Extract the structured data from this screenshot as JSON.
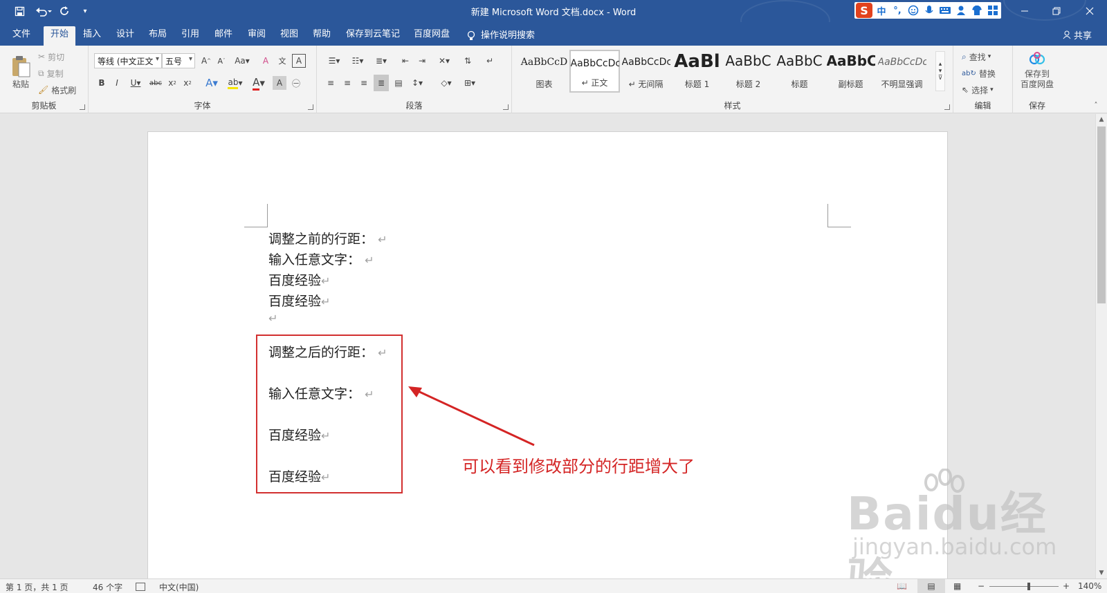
{
  "titlebar": {
    "title": "新建 Microsoft Word 文档.docx  -  Word",
    "qat_save_icon": "save-icon",
    "qat_undo_icon": "undo-icon",
    "qat_redo_icon": "redo-icon",
    "ime": [
      "中",
      "°,",
      "☺",
      "🎤",
      "⌨",
      "👤",
      "👕",
      "▦"
    ],
    "brand_color": "#2b579a"
  },
  "tabs": [
    {
      "label": "文件"
    },
    {
      "label": "开始"
    },
    {
      "label": "插入"
    },
    {
      "label": "设计"
    },
    {
      "label": "布局"
    },
    {
      "label": "引用"
    },
    {
      "label": "邮件"
    },
    {
      "label": "审阅"
    },
    {
      "label": "视图"
    },
    {
      "label": "帮助"
    },
    {
      "label": "保存到云笔记"
    },
    {
      "label": "百度网盘"
    }
  ],
  "tell_me": "操作说明搜索",
  "share": "共享",
  "ribbon": {
    "clipboard": {
      "paste": "粘贴",
      "cut": "剪切",
      "copy": "复制",
      "format_painter": "格式刷",
      "label": "剪贴板"
    },
    "font": {
      "font_name": "等线 (中文正文",
      "font_size": "五号",
      "label": "字体"
    },
    "paragraph": {
      "label": "段落"
    },
    "styles": {
      "label": "样式",
      "items": [
        {
          "sample": "AaBbCcD",
          "name": "图表"
        },
        {
          "sample": "AaBbCcDc",
          "name": "↵ 正文"
        },
        {
          "sample": "AaBbCcDc",
          "name": "↵ 无间隔"
        },
        {
          "sample": "AaBl",
          "name": "标题 1"
        },
        {
          "sample": "AaBbC",
          "name": "标题 2"
        },
        {
          "sample": "AaBbC",
          "name": "标题"
        },
        {
          "sample": "AaBbC",
          "name": "副标题"
        },
        {
          "sample": "AaBbCcDc",
          "name": "不明显强调"
        }
      ]
    },
    "editing": {
      "find": "查找",
      "replace": "替换",
      "select": "选择",
      "label": "编辑"
    },
    "save": {
      "button": "保存到\n百度网盘",
      "label": "保存"
    }
  },
  "document": {
    "before": [
      "调整之前的行距：",
      "输入任意文字：",
      "百度经验",
      "百度经验"
    ],
    "after": [
      "调整之后的行距：",
      "输入任意文字：",
      "百度经验",
      "百度经验"
    ],
    "para_mark": "↵",
    "annotation": "可以看到修改部分的行距增大了",
    "annotation_color": "#d42424"
  },
  "watermark": {
    "logo": "Baidu经验",
    "url": "jingyan.baidu.com"
  },
  "status": {
    "page": "第 1 页，共 1 页",
    "words": "46 个字",
    "language": "中文(中国)",
    "zoom": "140%",
    "zoom_level": 0.57
  }
}
